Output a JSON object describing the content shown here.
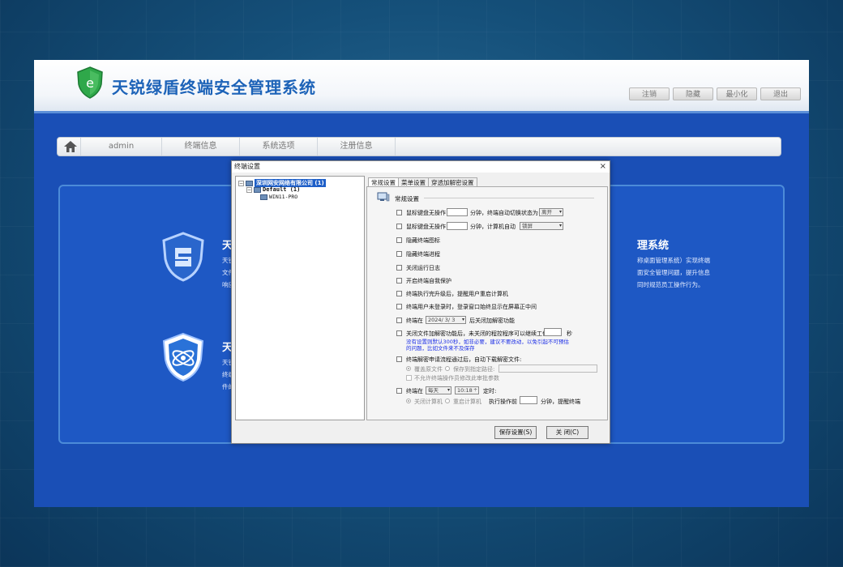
{
  "app": {
    "title": "天锐绿盾终端安全管理系统",
    "window_buttons": [
      "注销",
      "隐藏",
      "最小化",
      "退出"
    ]
  },
  "nav": {
    "items": [
      "admin",
      "终端信息",
      "系统选项",
      "注册信息"
    ]
  },
  "panel": {
    "feature1": {
      "title": "天",
      "text1": "天锐",
      "text2": "文件",
      "text3": "响应",
      "right_title": "理系统",
      "right_text1": "称桌面管理系统）实现终端",
      "right_text2": "面安全管理问题，提升信息",
      "right_text3": "同时规范员工操作行为。"
    },
    "feature2": {
      "title": "天",
      "text1": "天锐",
      "text2": "终端",
      "text3": "件的"
    }
  },
  "dialog": {
    "title": "终端设置",
    "close": "×",
    "tree": {
      "root": "深圳网安网络有限公司 (1)",
      "group": "Default (1)",
      "leaf": "WIN11-PRO"
    },
    "tabs": [
      "常规设置",
      "菜单设置",
      "穿透加解密设置"
    ],
    "section_title": "常规设置",
    "opt1": {
      "label": "鼠标键盘无操作",
      "unit": "分钟，终端自动切换状态为",
      "select": "离开"
    },
    "opt2": {
      "label": "鼠标键盘无操作",
      "unit": "分钟，计算机自动",
      "select": "锁屏"
    },
    "opt3": "隐藏终端图标",
    "opt4": "隐藏终端进程",
    "opt5": "关闭运行日志",
    "opt6": "开启终端自我保护",
    "opt7": "终端执行完升级后，提醒用户重启计算机",
    "opt8": "终端用户未登录时，登录窗口始终显示在屏幕正中间",
    "opt9": {
      "label": "终端在",
      "date": "2024/ 3/ 3",
      "suffix": "后关闭加解密功能"
    },
    "opt10": {
      "label": "关闭文件加解密功能后，未关闭的程控程序可以继续工作",
      "unit": "秒"
    },
    "note": [
      "没有设置则默认300秒，如非必要，建议不要改动，以免引起不可预估",
      "的问题，比如文件来不及保存"
    ],
    "opt11": {
      "label": "终端解密申请流程通过后，自动下载解密文件:",
      "r1": "覆盖原文件",
      "r2": "保存到指定路径:",
      "sub": "不允许终端操作员修改此审批参数"
    },
    "opt12": {
      "label": "终端在",
      "select": "每天",
      "time": "10:18",
      "suffix": "定时:",
      "r1": "关闭计算机",
      "r2": "重启计算机",
      "before": "执行操作前",
      "after": "分钟，提醒终端"
    },
    "buttons": {
      "save": "保存设置(S)",
      "close": "关 闭(C)"
    }
  }
}
